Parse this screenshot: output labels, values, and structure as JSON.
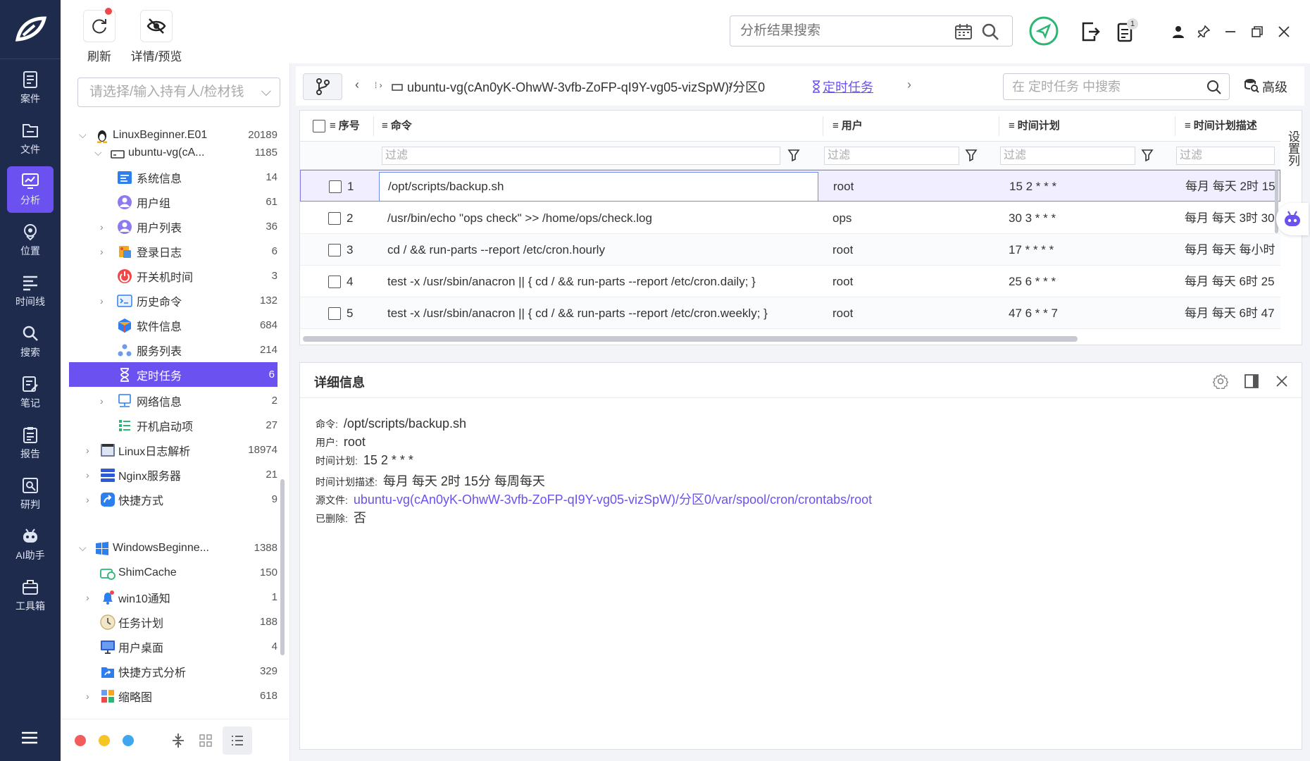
{
  "nav": {
    "items": [
      {
        "label": "案件",
        "icon": "case-icon"
      },
      {
        "label": "文件",
        "icon": "folder-icon"
      },
      {
        "label": "分析",
        "icon": "analysis-icon"
      },
      {
        "label": "位置",
        "icon": "location-icon"
      },
      {
        "label": "时间线",
        "icon": "timeline-icon"
      },
      {
        "label": "搜索",
        "icon": "search-icon"
      },
      {
        "label": "笔记",
        "icon": "note-icon"
      },
      {
        "label": "报告",
        "icon": "report-icon"
      },
      {
        "label": "研判",
        "icon": "judge-icon"
      },
      {
        "label": "AI助手",
        "icon": "robot-icon"
      },
      {
        "label": "工具箱",
        "icon": "toolbox-icon"
      }
    ],
    "active_index": 2,
    "accent": "#6b52f0",
    "background": "#1e2b4d"
  },
  "toolbar": {
    "refresh_label": "刷新",
    "preview_label": "详情/预览",
    "search_placeholder": "分析结果搜索",
    "notification_count": "1"
  },
  "tree": {
    "owner_placeholder": "请选择/输入持有人/检材钱",
    "rows": [
      {
        "label": "LinuxBeginner.E01",
        "count": "20189"
      },
      {
        "label": "ubuntu-vg(cA...",
        "count": "1185"
      },
      {
        "label": "系统信息",
        "count": "14"
      },
      {
        "label": "用户组",
        "count": "61"
      },
      {
        "label": "用户列表",
        "count": "36"
      },
      {
        "label": "登录日志",
        "count": "6"
      },
      {
        "label": "开关机时间",
        "count": "3"
      },
      {
        "label": "历史命令",
        "count": "132"
      },
      {
        "label": "软件信息",
        "count": "684"
      },
      {
        "label": "服务列表",
        "count": "214"
      },
      {
        "label": "定时任务",
        "count": "6"
      },
      {
        "label": "网络信息",
        "count": "2"
      },
      {
        "label": "开机启动项",
        "count": "27"
      },
      {
        "label": "Linux日志解析",
        "count": "18974"
      },
      {
        "label": "Nginx服务器",
        "count": "21"
      },
      {
        "label": "快捷方式",
        "count": "9"
      },
      {
        "label": "WindowsBeginne...",
        "count": "1388"
      },
      {
        "label": "ShimCache",
        "count": "150"
      },
      {
        "label": "win10通知",
        "count": "1"
      },
      {
        "label": "任务计划",
        "count": "188"
      },
      {
        "label": "用户桌面",
        "count": "4"
      },
      {
        "label": "快捷方式分析",
        "count": "329"
      },
      {
        "label": "缩略图",
        "count": "618"
      }
    ]
  },
  "crumbs": {
    "path": "ubuntu-vg(cAn0yK-OhwW-3vfb-ZoFP-qI9Y-vg05-vizSpW)/分区0",
    "current": "定时任务",
    "search_placeholder": "在 定时任务 中搜索",
    "advanced_label": "高级"
  },
  "table": {
    "columns": [
      "序号",
      "命令",
      "用户",
      "时间计划",
      "时间计划描述"
    ],
    "filter_placeholder": "过滤",
    "settings_label": "设置列",
    "rows": [
      {
        "idx": "1",
        "cmd": "/opt/scripts/backup.sh",
        "user": "root",
        "plan": "15 2 * * *",
        "desc": "每月 每天 2时 15"
      },
      {
        "idx": "2",
        "cmd": "/usr/bin/echo \"ops check\" >> /home/ops/check.log",
        "user": "ops",
        "plan": "30 3 * * *",
        "desc": "每月 每天 3时 30"
      },
      {
        "idx": "3",
        "cmd": "cd / && run-parts --report /etc/cron.hourly",
        "user": "root",
        "plan": "17 * * * *",
        "desc": "每月 每天 每小时"
      },
      {
        "idx": "4",
        "cmd": "test -x /usr/sbin/anacron || { cd / && run-parts --report /etc/cron.daily; }",
        "user": "root",
        "plan": "25 6 * * *",
        "desc": "每月 每天 6时 25"
      },
      {
        "idx": "5",
        "cmd": "test -x /usr/sbin/anacron || { cd / && run-parts --report /etc/cron.weekly; }",
        "user": "root",
        "plan": "47 6 * * 7",
        "desc": "每月 每天 6时 47"
      }
    ]
  },
  "detail": {
    "title": "详细信息",
    "fields": [
      {
        "key": "命令:",
        "value": "/opt/scripts/backup.sh"
      },
      {
        "key": "用户:",
        "value": "root"
      },
      {
        "key": "时间计划:",
        "value": "15 2 * * *"
      },
      {
        "key": "时间计划描述:",
        "value": "每月 每天 2时 15分 每周每天"
      },
      {
        "key": "源文件:",
        "value": "ubuntu-vg(cAn0yK-OhwW-3vfb-ZoFP-qI9Y-vg05-vizSpW)/分区0/var/spool/cron/crontabs/root"
      },
      {
        "key": "已删除:",
        "value": "否"
      }
    ]
  }
}
